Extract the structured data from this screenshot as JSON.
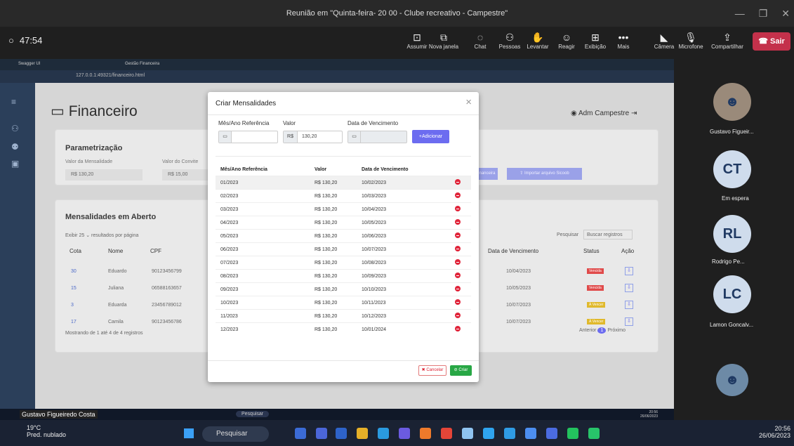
{
  "meeting": {
    "title": "Reunião em \"Quinta-feira- 20 00 - Clube recreativo - Campestre\"",
    "timer": "47:54",
    "buttons": [
      {
        "label": "Assumir",
        "x": ""
      },
      {
        "label": "Nova janela"
      },
      {
        "label": "Chat"
      },
      {
        "label": "Pessoas"
      },
      {
        "label": "Levantar"
      },
      {
        "label": "Reagir"
      },
      {
        "label": "Exibição"
      },
      {
        "label": "Mais"
      },
      {
        "label": "Câmera"
      },
      {
        "label": "Microfone"
      },
      {
        "label": "Compartilhar"
      }
    ],
    "leave": "Sair"
  },
  "browser": {
    "tab1": "Swagger UI",
    "tab2": "Gestão Financeira",
    "url": "127.0.0.1:49321/financeiro.html"
  },
  "app": {
    "title": "Financeiro",
    "user": "Adm Campestre",
    "param": {
      "title": "Parametrização",
      "label_mensal": "Valor da Mensalidade",
      "label_convite": "Valor do Convite",
      "mensal_prefix": "R$",
      "mensal": "130,20",
      "convite_prefix": "R$",
      "convite": "15,00",
      "btn_fin": "nanceira",
      "btn_import": "Importar arquivo Sicoob"
    },
    "open": {
      "title": "Mensalidades em Aberto",
      "exibir": "Exibir",
      "per_page": "25",
      "results": "resultados por página",
      "pesquisar": "Pesquisar",
      "search_ph": "Buscar registros",
      "cols": [
        "Cota",
        "Nome",
        "CPF"
      ],
      "cols_right": [
        "Data de Vencimento",
        "Status",
        "Ação"
      ],
      "rows": [
        {
          "cota": "30",
          "nome": "Eduardo",
          "cpf": "90123456799",
          "venc": "10/04/2023",
          "status": "Vencida",
          "scolor": "#e04a4a"
        },
        {
          "cota": "15",
          "nome": "Juliana",
          "cpf": "06588163657",
          "venc": "10/05/2023",
          "status": "Vencida",
          "scolor": "#e04a4a"
        },
        {
          "cota": "3",
          "nome": "Eduarda",
          "cpf": "23456789012",
          "venc": "10/07/2023",
          "status": "À Vencer",
          "scolor": "#e0b92c"
        },
        {
          "cota": "17",
          "nome": "Camila",
          "cpf": "90123456786",
          "venc": "10/07/2023",
          "status": "À Vencer",
          "scolor": "#e0b92c"
        }
      ],
      "footer": "Mostrando de 1 até 4 de 4 registros",
      "prev": "Anterior",
      "page": "1",
      "next": "Próximo"
    }
  },
  "modal": {
    "title": "Criar Mensalidades",
    "close": "×",
    "label_mes": "Mês/Ano Referência",
    "label_valor": "Valor",
    "label_venc": "Data de Vencimento",
    "valor_prefix": "R$",
    "valor": "130,20",
    "add": "+Adicionar",
    "headers": [
      "Mês/Ano Referência",
      "Valor",
      "Data de Vencimento"
    ],
    "rows": [
      [
        "01/2023",
        "R$ 130,20",
        "10/02/2023"
      ],
      [
        "02/2023",
        "R$ 130,20",
        "10/03/2023"
      ],
      [
        "03/2023",
        "R$ 130,20",
        "10/04/2023"
      ],
      [
        "04/2023",
        "R$ 130,20",
        "10/05/2023"
      ],
      [
        "05/2023",
        "R$ 130,20",
        "10/06/2023"
      ],
      [
        "06/2023",
        "R$ 130,20",
        "10/07/2023"
      ],
      [
        "07/2023",
        "R$ 130,20",
        "10/08/2023"
      ],
      [
        "08/2023",
        "R$ 130,20",
        "10/09/2023"
      ],
      [
        "09/2023",
        "R$ 130,20",
        "10/10/2023"
      ],
      [
        "10/2023",
        "R$ 130,20",
        "10/11/2023"
      ],
      [
        "11/2023",
        "R$ 130,20",
        "10/12/2023"
      ],
      [
        "12/2023",
        "R$ 130,20",
        "10/01/2024"
      ]
    ],
    "cancel": "✖ Cancelar",
    "create": "⊘ Criar"
  },
  "participants": [
    {
      "name": "Gustavo Figueir...",
      "initials": ""
    },
    {
      "name": "Em espera",
      "initials": "CT"
    },
    {
      "name": "Rodrigo Pe...",
      "initials": "RL"
    },
    {
      "name": "Lamon Goncalv...",
      "initials": "LC"
    }
  ],
  "presenter": "Gustavo Figueiredo Costa",
  "inner_task": {
    "search": "Pesquisar",
    "time": "20:56",
    "date": "26/06/2023"
  },
  "taskbar": {
    "temp": "19°C",
    "weather": "Pred. nublado",
    "search": "Pesquisar",
    "time": "20:56",
    "date": "26/06/2023"
  }
}
